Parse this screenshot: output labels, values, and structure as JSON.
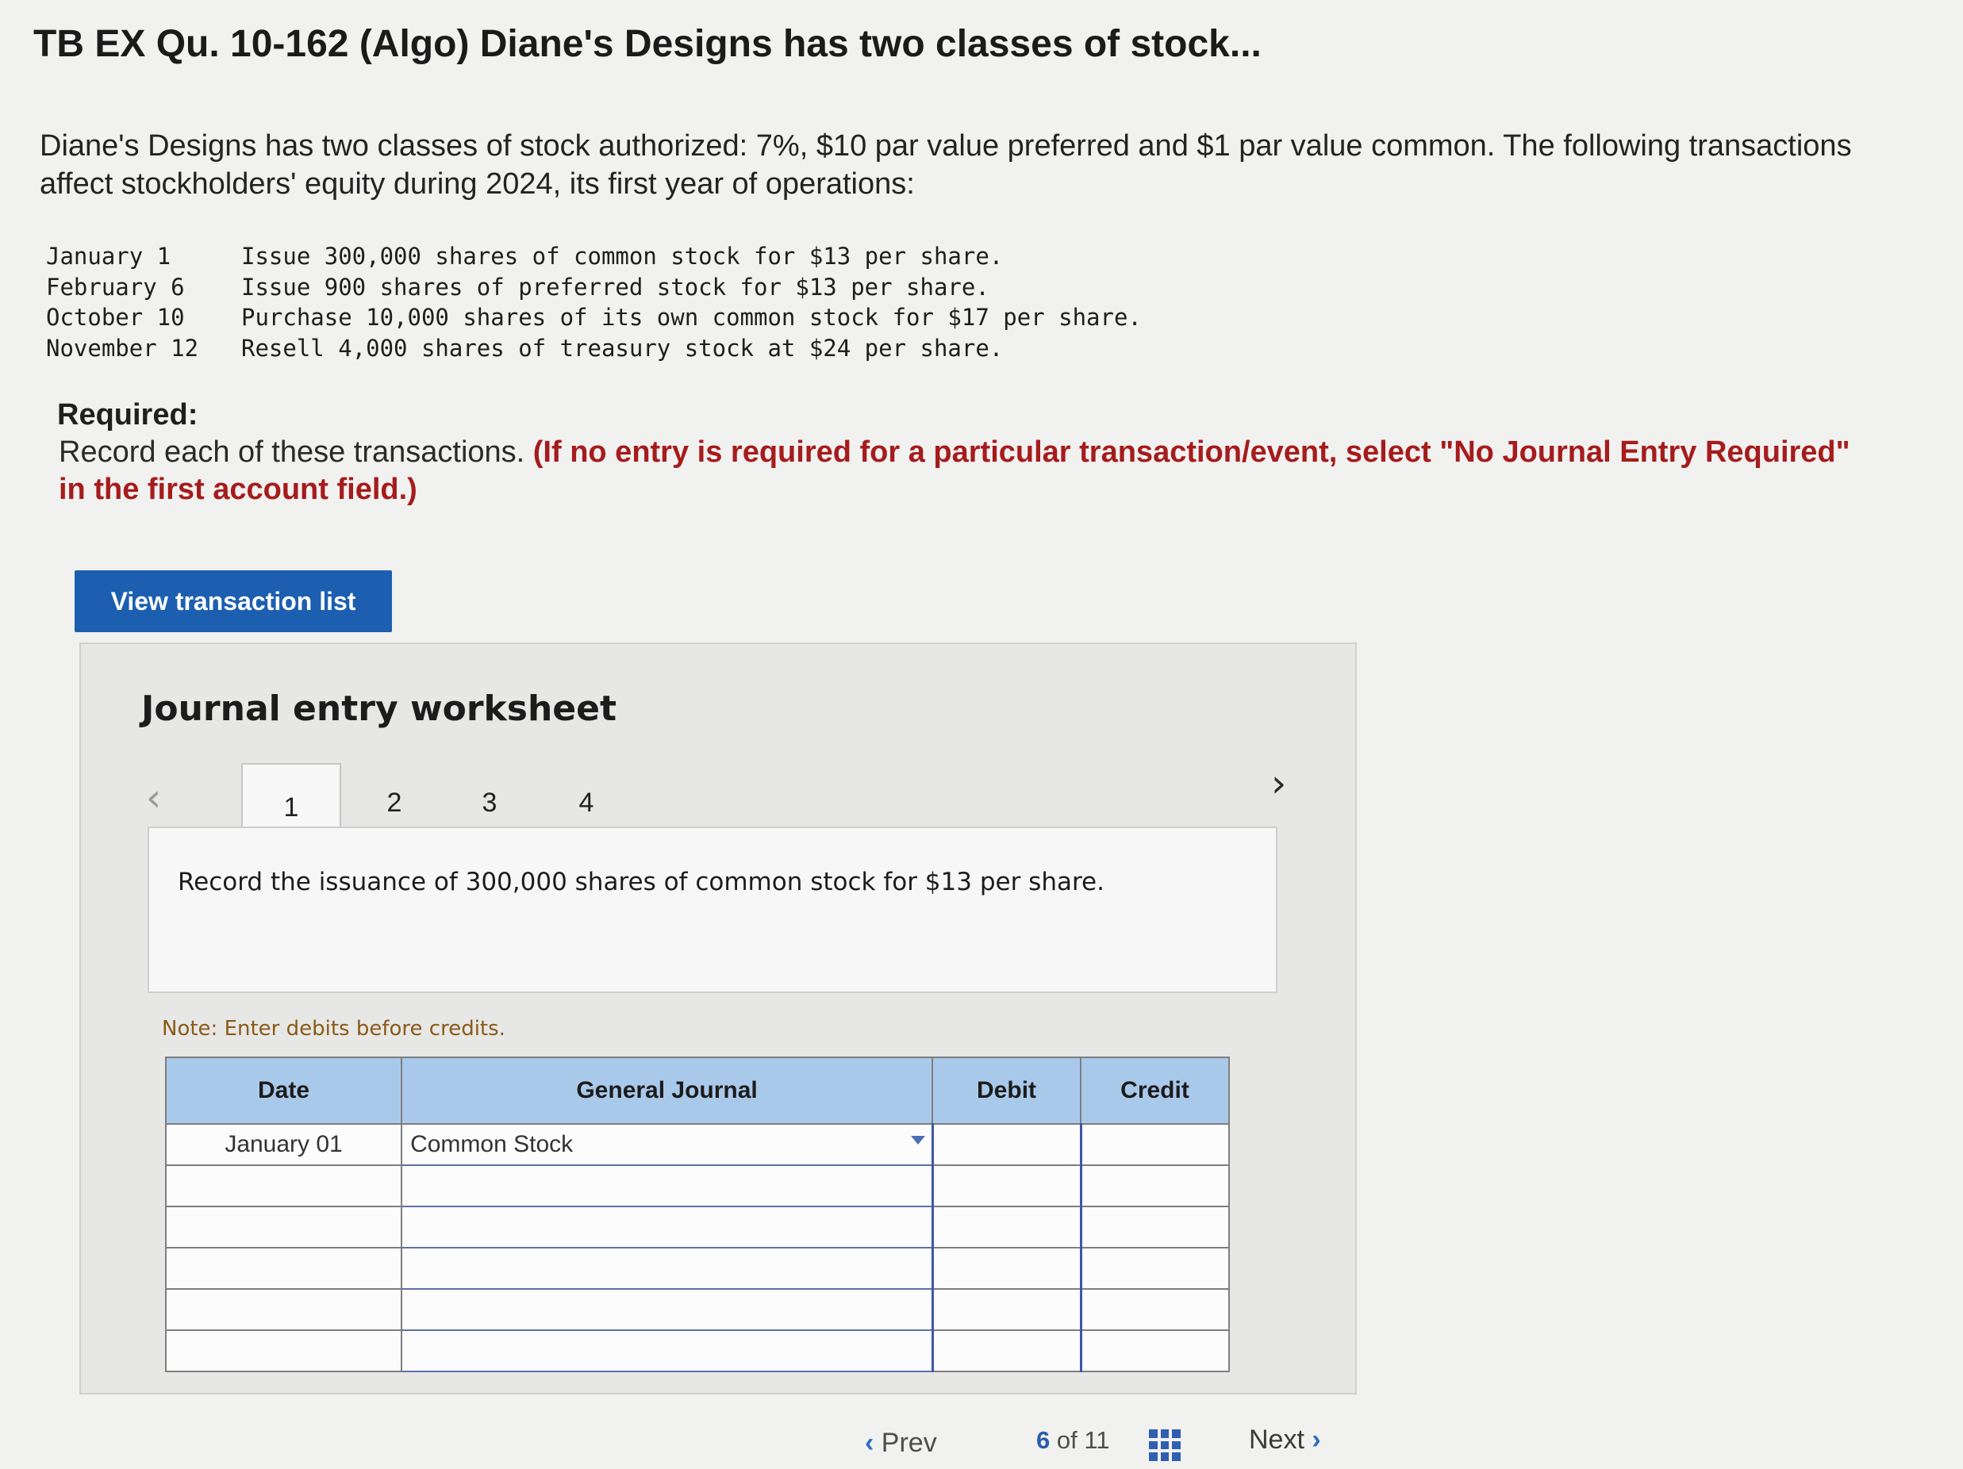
{
  "page": {
    "title": "TB EX Qu. 10-162 (Algo) Diane's Designs has two classes of stock...",
    "intro": "Diane's Designs has two classes of stock authorized: 7%, $10 par value preferred and $1 par value common. The following transactions affect stockholders' equity during 2024, its first year of operations:"
  },
  "transactions": [
    {
      "date": "January 1",
      "text": "Issue 300,000 shares of common stock for $13 per share."
    },
    {
      "date": "February 6",
      "text": "Issue 900 shares of preferred stock for $13 per share."
    },
    {
      "date": "October 10",
      "text": "Purchase 10,000 shares of its own common stock for $17 per share."
    },
    {
      "date": "November 12",
      "text": "Resell 4,000 shares of treasury stock at $24 per share."
    }
  ],
  "required": {
    "heading": "Required:",
    "text": "Record each of these transactions.",
    "instruction": "(If no entry is required for a particular transaction/event, select \"No Journal Entry Required\" in the first account field.)"
  },
  "buttons": {
    "view_transaction_list": "View transaction list"
  },
  "worksheet": {
    "title": "Journal entry worksheet",
    "tabs": [
      "1",
      "2",
      "3",
      "4"
    ],
    "active_tab": "1",
    "prompt": "Record the issuance of 300,000 shares of common stock for $13 per share.",
    "note": "Note: Enter debits before credits.",
    "columns": {
      "date": "Date",
      "journal": "General Journal",
      "debit": "Debit",
      "credit": "Credit"
    },
    "rows": [
      {
        "date": "January 01",
        "account": "Common Stock",
        "debit": "",
        "credit": ""
      },
      {
        "date": "",
        "account": "",
        "debit": "",
        "credit": ""
      },
      {
        "date": "",
        "account": "",
        "debit": "",
        "credit": ""
      },
      {
        "date": "",
        "account": "",
        "debit": "",
        "credit": ""
      },
      {
        "date": "",
        "account": "",
        "debit": "",
        "credit": ""
      },
      {
        "date": "",
        "account": "",
        "debit": "",
        "credit": ""
      }
    ]
  },
  "pager": {
    "prev": "Prev",
    "current": "6",
    "of": "of",
    "total": "11",
    "next": "Next"
  },
  "colors": {
    "button_blue": "#1c5fb0",
    "header_blue": "#a9c9ea",
    "warning_red": "#a51c1c",
    "note_brown": "#8a5a16"
  },
  "icons": [
    "chevron-left-icon",
    "chevron-right-icon",
    "grid-icon",
    "dropdown-arrow-icon"
  ]
}
